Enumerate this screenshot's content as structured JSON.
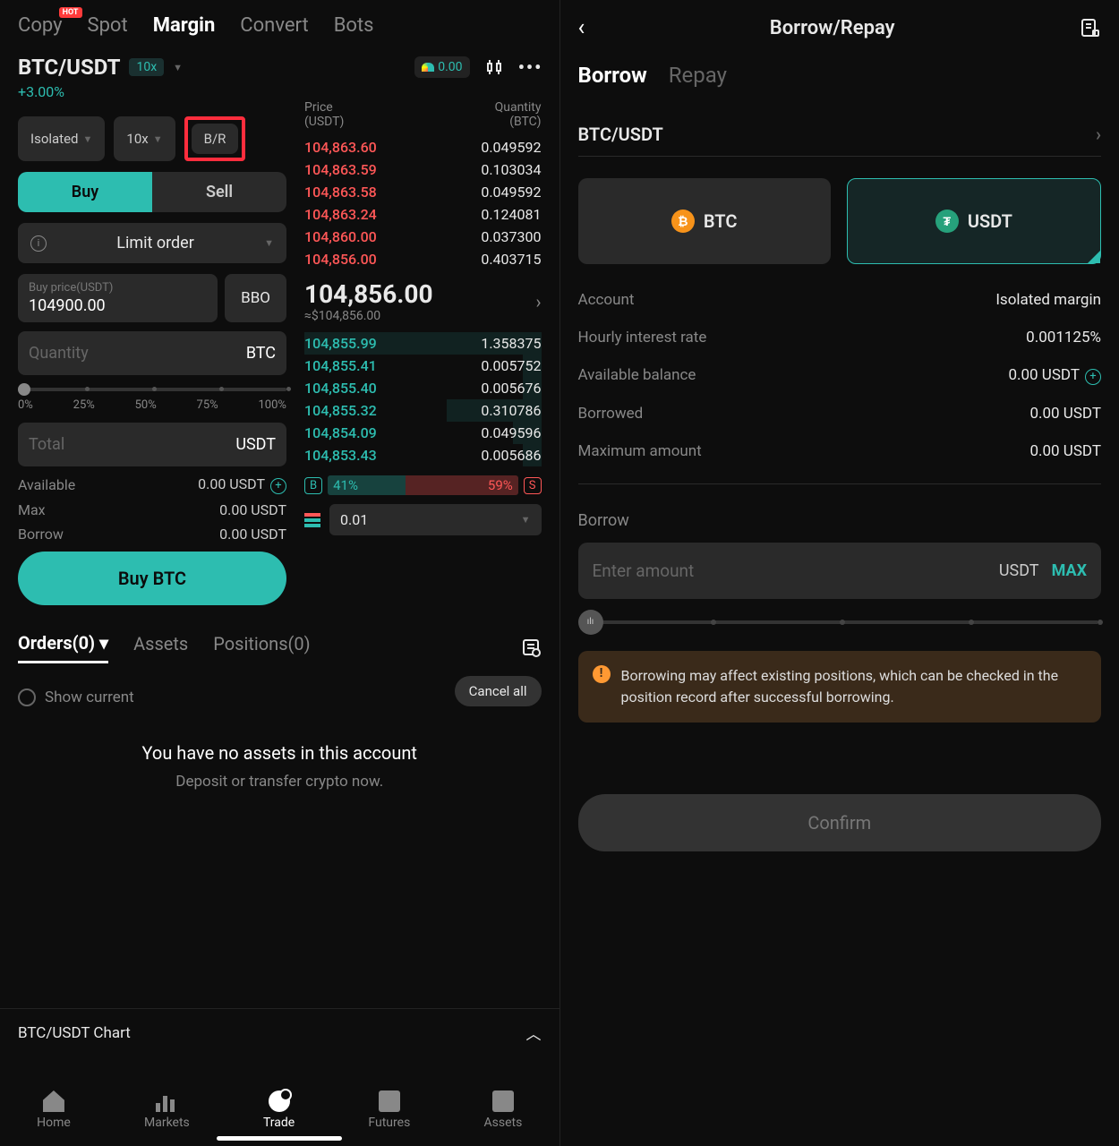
{
  "topNav": {
    "copy": "Copy",
    "hot": "HOT",
    "spot": "Spot",
    "margin": "Margin",
    "convert": "Convert",
    "bots": "Bots"
  },
  "pair": {
    "name": "BTC/USDT",
    "leverage": "10x",
    "change": "+3.00%",
    "gauge": "0.00"
  },
  "modes": {
    "isolated": "Isolated",
    "lev": "10x",
    "br": "B/R"
  },
  "bs": {
    "buy": "Buy",
    "sell": "Sell"
  },
  "orderType": "Limit order",
  "price": {
    "label": "Buy price(USDT)",
    "value": "104900.00",
    "bbo": "BBO"
  },
  "qty": {
    "placeholder": "Quantity",
    "unit": "BTC"
  },
  "sliderLabels": [
    "0%",
    "25%",
    "50%",
    "75%",
    "100%"
  ],
  "total": {
    "label": "Total",
    "unit": "USDT"
  },
  "acct": {
    "available": {
      "label": "Available",
      "value": "0.00 USDT"
    },
    "max": {
      "label": "Max",
      "value": "0.00 USDT"
    },
    "borrow": {
      "label": "Borrow",
      "value": "0.00 USDT"
    }
  },
  "actionBtn": "Buy BTC",
  "orderbook": {
    "priceLabel": "Price",
    "priceUnit": "(USDT)",
    "qtyLabel": "Quantity",
    "qtyUnit": "(BTC)",
    "asks": [
      {
        "p": "104,863.60",
        "q": "0.049592"
      },
      {
        "p": "104,863.59",
        "q": "0.103034"
      },
      {
        "p": "104,863.58",
        "q": "0.049592"
      },
      {
        "p": "104,863.24",
        "q": "0.124081"
      },
      {
        "p": "104,860.00",
        "q": "0.037300"
      },
      {
        "p": "104,856.00",
        "q": "0.403715"
      }
    ],
    "mid": "104,856.00",
    "midSub": "≈$104,856.00",
    "bids": [
      {
        "p": "104,855.99",
        "q": "1.358375"
      },
      {
        "p": "104,855.41",
        "q": "0.005752"
      },
      {
        "p": "104,855.40",
        "q": "0.005676"
      },
      {
        "p": "104,855.32",
        "q": "0.310786"
      },
      {
        "p": "104,854.09",
        "q": "0.049596"
      },
      {
        "p": "104,853.43",
        "q": "0.005686"
      }
    ],
    "depthB": "B",
    "depthBuyPct": "41%",
    "depthSellPct": "59%",
    "depthS": "S",
    "precision": "0.01"
  },
  "bottomTabs": {
    "orders": "Orders(0)",
    "assets": "Assets",
    "positions": "Positions(0)",
    "cancelAll": "Cancel all",
    "showCurrent": "Show current"
  },
  "empty": {
    "title": "You have no assets in this account",
    "sub": "Deposit or transfer crypto now."
  },
  "chartBar": "BTC/USDT  Chart",
  "nav": {
    "home": "Home",
    "markets": "Markets",
    "trade": "Trade",
    "futures": "Futures",
    "assets": "Assets"
  },
  "right": {
    "title": "Borrow/Repay",
    "tabs": {
      "borrow": "Borrow",
      "repay": "Repay"
    },
    "pair": "BTC/USDT",
    "assets": {
      "btc": "BTC",
      "usdt": "USDT"
    },
    "rows": {
      "account": {
        "label": "Account",
        "value": "Isolated margin"
      },
      "rate": {
        "label": "Hourly interest rate",
        "value": "0.001125%"
      },
      "avail": {
        "label": "Available balance",
        "value": "0.00 USDT"
      },
      "borrowed": {
        "label": "Borrowed",
        "value": "0.00 USDT"
      },
      "max": {
        "label": "Maximum amount",
        "value": "0.00 USDT"
      }
    },
    "section": "Borrow",
    "input": {
      "placeholder": "Enter amount",
      "unit": "USDT",
      "max": "MAX"
    },
    "warning": "Borrowing may affect existing positions, which can be checked in the position record after successful borrowing.",
    "confirm": "Confirm"
  }
}
